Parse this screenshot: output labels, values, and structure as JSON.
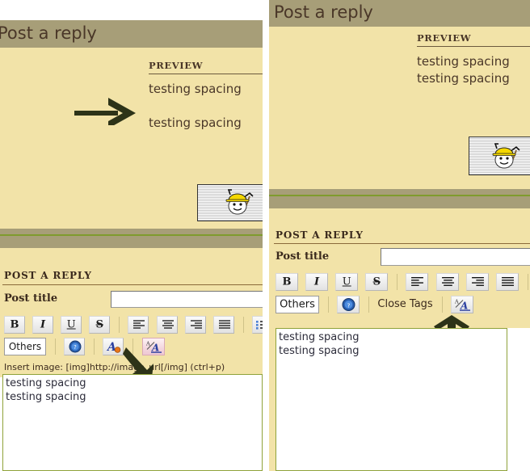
{
  "page": {
    "header_title": "Post a reply",
    "accent_band": "#a79e78",
    "cream_bg": "#f2e3a8",
    "green_line": "#7f9b2e",
    "text_color": "#4a3728",
    "highlight_pink": "#eec8d3"
  },
  "left": {
    "header_title": "Post a reply",
    "preview": {
      "title": "PREVIEW",
      "lines": [
        "testing spacing",
        "",
        "testing spacing"
      ],
      "line1": "testing spacing",
      "line2": "testing spacing"
    },
    "attachment": {
      "alt": "miner-smiley"
    },
    "section_title": "POST A REPLY",
    "post_title_label": "Post title",
    "post_title_value": "",
    "post_title_placeholder": "",
    "toolbar": {
      "row1": [
        {
          "name": "bold-button",
          "label": "B",
          "style": "bold",
          "state": "normal"
        },
        {
          "name": "italic-button",
          "label": "I",
          "style": "italic",
          "state": "normal"
        },
        {
          "name": "underline-button",
          "label": "U",
          "style": "underline",
          "state": "normal"
        },
        {
          "name": "strikethrough-button",
          "label": "S",
          "style": "strike",
          "state": "normal"
        },
        {
          "name": "align-left-button",
          "label": "",
          "style": "align-left",
          "state": "normal"
        },
        {
          "name": "align-center-button",
          "label": "",
          "style": "align-center",
          "state": "normal"
        },
        {
          "name": "align-right-button",
          "label": "",
          "style": "align-right",
          "state": "normal"
        },
        {
          "name": "align-justify-button",
          "label": "",
          "style": "align-justify",
          "state": "normal"
        },
        {
          "name": "bullet-list-button",
          "label": "",
          "style": "ul",
          "state": "normal"
        },
        {
          "name": "numbered-list-button",
          "label": "",
          "style": "ol",
          "state": "normal"
        }
      ],
      "row2": [
        {
          "name": "others-button",
          "label": "Others",
          "style": "text",
          "state": "plain"
        },
        {
          "name": "smiley-button",
          "label": "",
          "style": "smiley",
          "state": "normal"
        },
        {
          "name": "font-color-button",
          "label": "",
          "style": "font-color",
          "state": "normal"
        },
        {
          "name": "font-size-button",
          "label": "",
          "style": "font-size",
          "state": "highlighted"
        }
      ]
    },
    "hint": "Insert image: [img]http://image_url[/img] (ctrl+p)",
    "message_value": "testing spacing\ntesting spacing",
    "arrow": {
      "name": "right-arrow-annotation",
      "direction": "right"
    },
    "arrow2": {
      "name": "up-left-arrow-annotation",
      "direction": "up-left"
    }
  },
  "right": {
    "header_title": "Post a reply",
    "preview": {
      "title": "PREVIEW",
      "lines": [
        "testing spacing",
        "testing spacing"
      ],
      "line1": "testing spacing",
      "line2": "testing spacing"
    },
    "attachment": {
      "alt": "miner-smiley"
    },
    "section_title": "POST A REPLY",
    "post_title_label": "Post title",
    "post_title_value": "",
    "post_title_placeholder": "",
    "toolbar": {
      "row1": [
        {
          "name": "bold-button",
          "label": "B",
          "style": "bold",
          "state": "normal"
        },
        {
          "name": "italic-button",
          "label": "I",
          "style": "italic",
          "state": "normal"
        },
        {
          "name": "underline-button",
          "label": "U",
          "style": "underline",
          "state": "normal"
        },
        {
          "name": "strikethrough-button",
          "label": "S",
          "style": "strike",
          "state": "normal"
        },
        {
          "name": "align-left-button",
          "label": "",
          "style": "align-left",
          "state": "normal"
        },
        {
          "name": "align-center-button",
          "label": "",
          "style": "align-center",
          "state": "normal"
        },
        {
          "name": "align-right-button",
          "label": "",
          "style": "align-right",
          "state": "normal"
        },
        {
          "name": "align-justify-button",
          "label": "",
          "style": "align-justify",
          "state": "normal"
        },
        {
          "name": "bullet-list-button",
          "label": "",
          "style": "ul",
          "state": "normal"
        },
        {
          "name": "numbered-list-button",
          "label": "",
          "style": "ol",
          "state": "normal"
        }
      ],
      "row2": [
        {
          "name": "others-button",
          "label": "Others",
          "style": "text",
          "state": "plain"
        },
        {
          "name": "smiley-button",
          "label": "",
          "style": "smiley",
          "state": "normal"
        },
        {
          "name": "close-tags-button",
          "label": "Close Tags",
          "style": "plaintext",
          "state": "text"
        },
        {
          "name": "font-size-button",
          "label": "",
          "style": "font-size",
          "state": "normal"
        }
      ]
    },
    "message_value": "testing spacing\ntesting spacing",
    "arrow": {
      "name": "up-arrow-annotation",
      "direction": "up"
    }
  }
}
